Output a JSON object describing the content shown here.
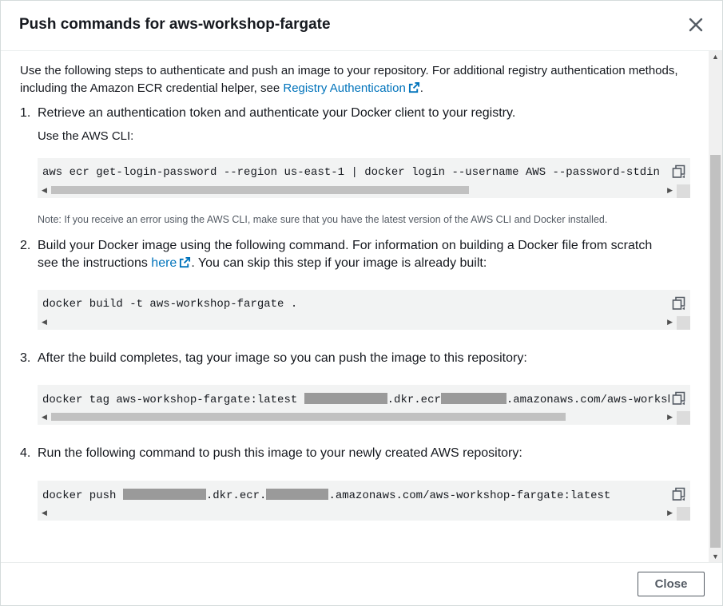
{
  "modal": {
    "title": "Push commands for aws-workshop-fargate",
    "intro_text": "Use the following steps to authenticate and push an image to your repository. For additional registry authentication methods, including the Amazon ECR credential helper, see ",
    "intro_link": "Registry Authentication",
    "intro_end": ".",
    "close_button": "Close"
  },
  "steps": [
    {
      "number": "1.",
      "text": "Retrieve an authentication token and authenticate your Docker client to your registry.",
      "sub": "Use the AWS CLI:",
      "command": "aws ecr get-login-password --region us-east-1 | docker login --username AWS --password-stdin",
      "note": "Note: If you receive an error using the AWS CLI, make sure that you have the latest version of the AWS CLI and Docker installed."
    },
    {
      "number": "2.",
      "text_before": "Build your Docker image using the following command. For information on building a Docker file from scratch see the instructions ",
      "link": "here",
      "text_after": ". You can skip this step if your image is already built:",
      "command": "docker build -t aws-workshop-fargate ."
    },
    {
      "number": "3.",
      "text": "After the build completes, tag your image so you can push the image to this repository:",
      "command_part1": "docker tag aws-workshop-fargate:latest ",
      "command_part2": ".dkr.ecr",
      "command_part3": ".amazonaws.com/aws-workshop-fargate:latest"
    },
    {
      "number": "4.",
      "text": "Run the following command to push this image to your newly created AWS repository:",
      "command_part1": "docker push ",
      "command_part2": ".dkr.ecr.",
      "command_part3": ".amazonaws.com/aws-workshop-fargate:latest"
    }
  ],
  "colors": {
    "link": "#0073bb",
    "code_bg": "#f2f3f3",
    "text": "#16191f",
    "muted": "#545b64"
  }
}
